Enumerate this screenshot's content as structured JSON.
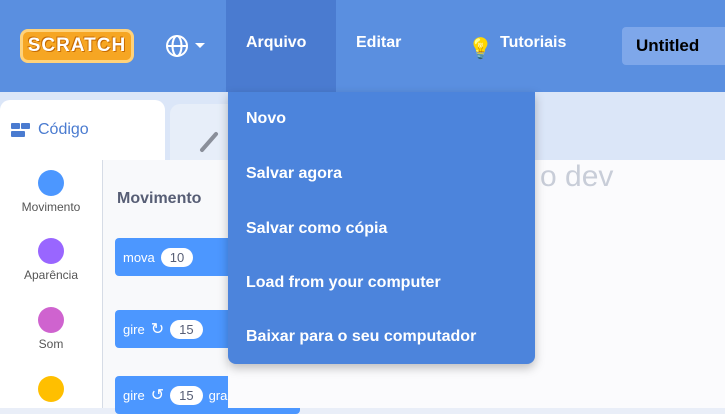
{
  "menubar": {
    "logo": "SCRATCH",
    "language_icon": "globe-icon",
    "file": "Arquivo",
    "edit": "Editar",
    "tutorials": "Tutoriais",
    "project_title": "Untitled"
  },
  "tabs": {
    "code": "Código"
  },
  "categories": [
    {
      "label": "Movimento",
      "color": "#4c97ff"
    },
    {
      "label": "Aparência",
      "color": "#9966ff"
    },
    {
      "label": "Som",
      "color": "#cf63cf"
    },
    {
      "label": "",
      "color": "#ffbf00"
    }
  ],
  "palette": {
    "title": "Movimento",
    "blocks": [
      {
        "verb": "mova",
        "value": "10"
      },
      {
        "verb": "gire",
        "value": "15"
      },
      {
        "verb": "gire",
        "value": "15",
        "suffix": "graus"
      }
    ]
  },
  "file_menu": {
    "items": [
      "Novo",
      "Salvar agora",
      "Salvar como cópia",
      "Load from your computer",
      "Baixar para o seu computador"
    ]
  },
  "stage_ghost_text": "o dev"
}
